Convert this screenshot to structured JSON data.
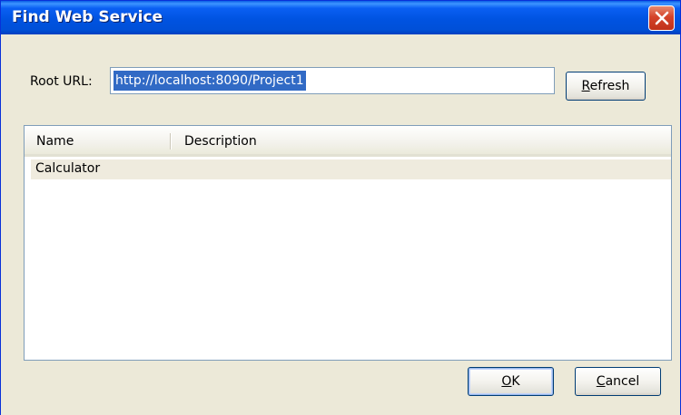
{
  "window": {
    "title": "Find Web Service"
  },
  "root_url": {
    "label": "Root URL:",
    "value": "http://localhost:8090/Project1"
  },
  "buttons": {
    "refresh": {
      "label_first": "R",
      "label_rest": "efresh"
    },
    "ok": {
      "label_first": "O",
      "label_rest": "K"
    },
    "cancel": {
      "label_first": "C",
      "label_rest": "ancel"
    }
  },
  "table": {
    "columns": [
      "Name",
      "Description"
    ],
    "rows": [
      {
        "name": "Calculator",
        "description": ""
      }
    ]
  },
  "colors": {
    "titlebar": "#0053e1",
    "selection": "#316ac5",
    "dialog_bg": "#ece9d8",
    "close_button": "#d4432a"
  },
  "icons": {
    "close": "close-icon"
  }
}
